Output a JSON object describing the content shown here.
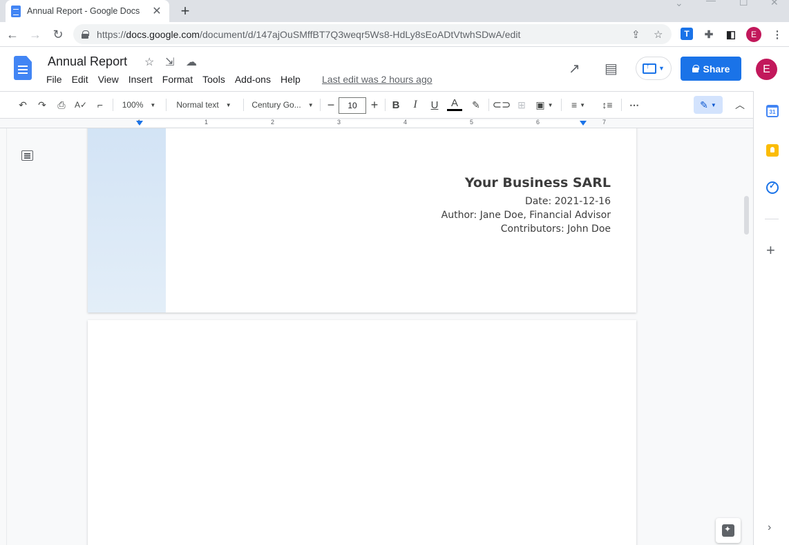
{
  "browser": {
    "tab_title": "Annual Report - Google Docs",
    "url_host": "docs.google.com",
    "url_path": "/document/d/147ajOuSMffBT7Q3weqr5Ws8-HdLy8sEoADtVtwhSDwA/edit",
    "url_scheme": "https://",
    "extension_label": "T",
    "profile_initial": "E"
  },
  "docs": {
    "title": "Annual Report",
    "menu": [
      "File",
      "Edit",
      "View",
      "Insert",
      "Format",
      "Tools",
      "Add-ons",
      "Help"
    ],
    "last_edit": "Last edit was 2 hours ago",
    "share_label": "Share",
    "avatar_initial": "E"
  },
  "toolbar": {
    "zoom": "100%",
    "style": "Normal text",
    "font": "Century Go...",
    "font_size": "10"
  },
  "ruler": {
    "numbers": [
      "1",
      "1",
      "2",
      "3",
      "4",
      "5",
      "6",
      "7"
    ]
  },
  "document": {
    "business_name": "Your Business SARL",
    "date_line": "Date: 2021-12-16",
    "author_line": "Author: Jane Doe, Financial Advisor",
    "contributors_line": "Contributors: John Doe"
  },
  "side_panel": {
    "calendar_label": "31"
  },
  "colors": {
    "accent": "#1a73e8",
    "avatar": "#c2185b",
    "keep": "#fbbc04"
  }
}
